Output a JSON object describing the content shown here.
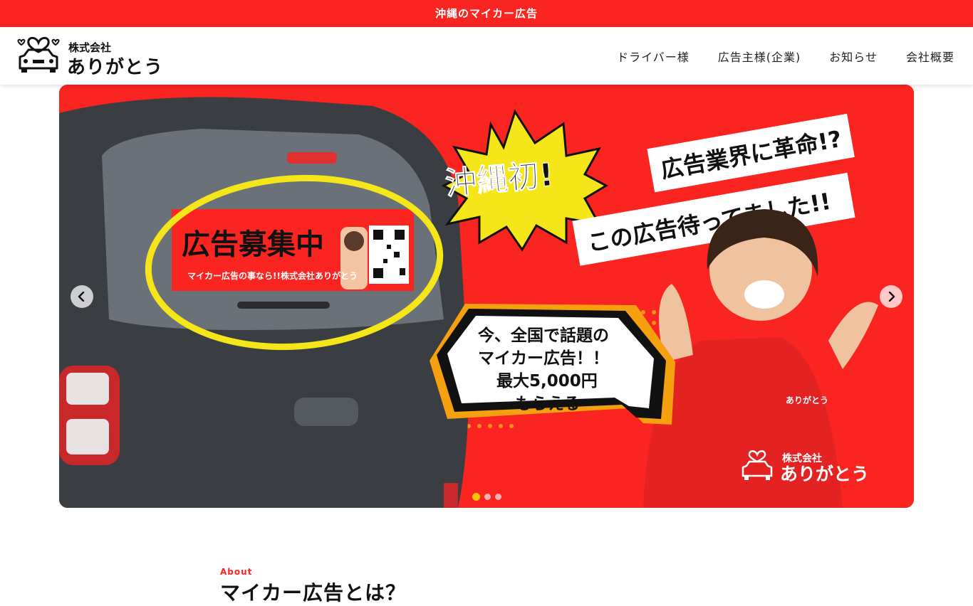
{
  "topbar": {
    "text": "沖縄のマイカー広告"
  },
  "header": {
    "logo_small": "株式会社",
    "logo_big": "ありがとう"
  },
  "nav": [
    {
      "label": "ドライバー様"
    },
    {
      "label": "広告主様(企業)"
    },
    {
      "label": "お知らせ"
    },
    {
      "label": "会社概要"
    }
  ],
  "hero": {
    "burst_text": "沖縄初!",
    "headline_1": "広告業界に革命!?",
    "headline_2": "この広告待ってました!!",
    "bubble_lines": [
      "今、全国で話題の",
      "マイカー広告！！",
      "最大5,000円",
      "もらえる"
    ],
    "banner_title": "広告募集中",
    "banner_sub": "マイカー広告の事なら!!株式会社ありがとう",
    "corner_small": "株式会社",
    "corner_big": "ありがとう",
    "shirt_text": "ありがとう",
    "dots": 3,
    "active_dot": 0
  },
  "about": {
    "label": "About",
    "title": "マイカー広告とは？"
  },
  "colors": {
    "brand_red": "#fa2420",
    "yellow": "#f5e61a",
    "dot_active": "#f5c400"
  }
}
